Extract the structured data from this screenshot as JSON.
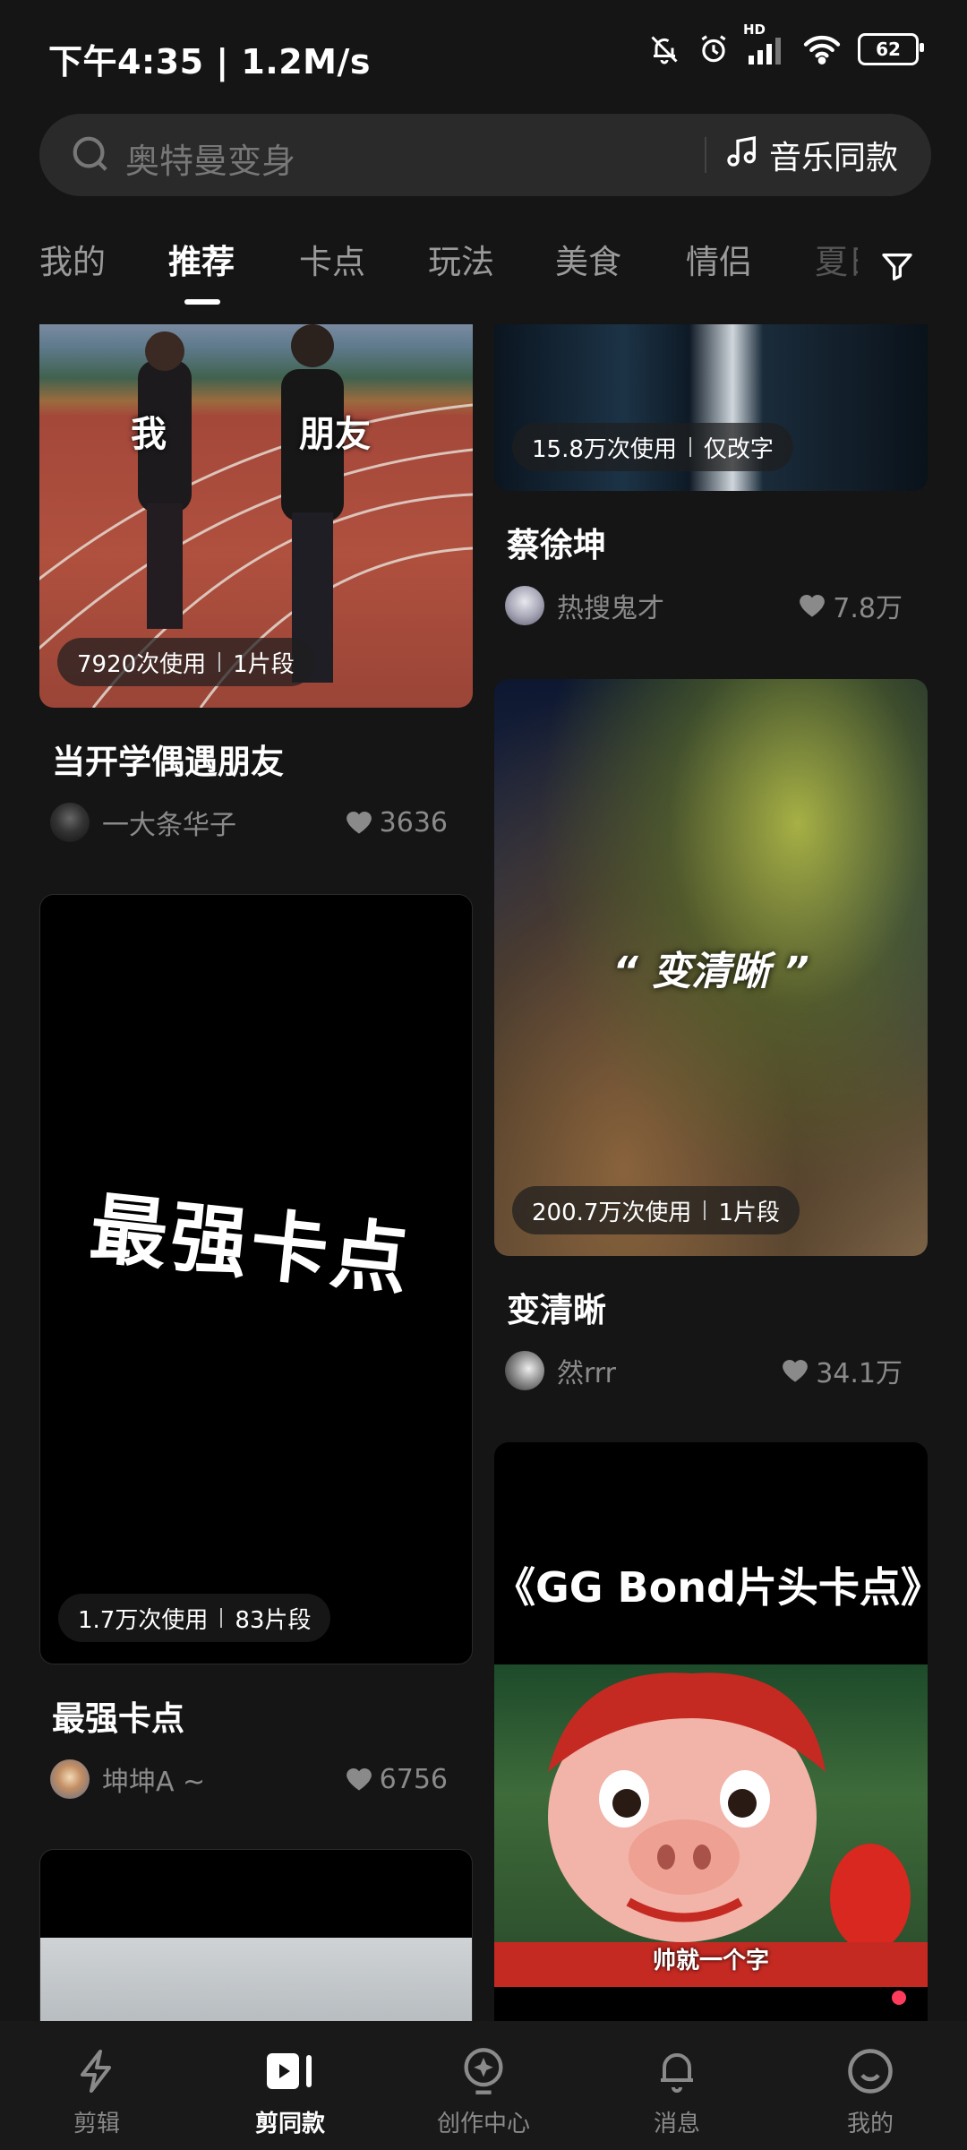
{
  "status_bar": {
    "time_speed": "下午4:35 | 1.2M/s",
    "network": "HD",
    "battery": "62",
    "icons": [
      "mute-icon",
      "alarm-icon",
      "signal-icon",
      "wifi-icon",
      "battery-icon"
    ]
  },
  "search": {
    "placeholder": "奥特曼变身",
    "music_button": "音乐同款",
    "icons": [
      "search-icon",
      "music-note-icon"
    ]
  },
  "tabs": [
    "我的",
    "推荐",
    "卡点",
    "玩法",
    "美食",
    "情侣",
    "夏日"
  ],
  "active_tab": "推荐",
  "feed": {
    "left": [
      {
        "thumb_text_1": "我",
        "thumb_text_2": "朋友",
        "uses": "7920次使用",
        "segments": "1片段",
        "title": "当开学偶遇朋友",
        "author": "一大条华子",
        "likes": "3636"
      },
      {
        "thumb_text": "最强卡点",
        "uses": "1.7万次使用",
        "segments": "83片段",
        "title": "最强卡点",
        "author": "坤坤A ~",
        "likes": "6756"
      }
    ],
    "right": [
      {
        "uses": "15.8万次使用",
        "tag": "仅改字",
        "title": "蔡徐坤",
        "author": "热搜鬼才",
        "likes": "7.8万"
      },
      {
        "thumb_text": "“ 变清晰 ”",
        "uses": "200.7万次使用",
        "segments": "1片段",
        "title": "变清晰",
        "author": "然rrr",
        "likes": "34.1万"
      },
      {
        "thumb_title": "《GG Bond片头卡点》",
        "subtitle": "帅就一个字"
      }
    ]
  },
  "bottom_nav": [
    {
      "label": "剪辑",
      "icon": "lightning-icon"
    },
    {
      "label": "剪同款",
      "icon": "play-template-icon"
    },
    {
      "label": "创作中心",
      "icon": "bulb-icon"
    },
    {
      "label": "消息",
      "icon": "bell-icon"
    },
    {
      "label": "我的",
      "icon": "smile-icon"
    }
  ],
  "active_nav": "剪同款",
  "colors": {
    "background": "#151515",
    "notification_dot": "#ff3b5c"
  }
}
